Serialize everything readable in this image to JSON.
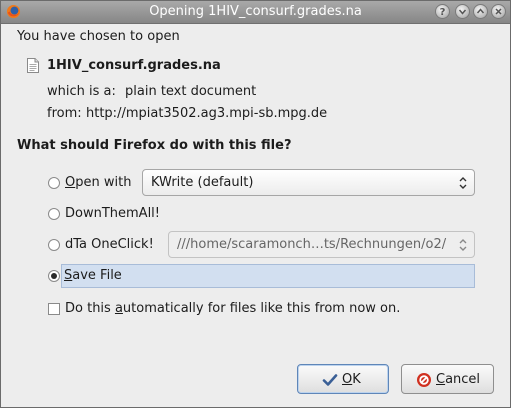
{
  "window": {
    "title": "Opening 1HIV_consurf.grades.na",
    "app_icon": "firefox-icon",
    "controls": [
      "help-icon",
      "minimize-icon",
      "maximize-icon",
      "close-icon"
    ]
  },
  "intro": {
    "chosen_text": "You have chosen to open",
    "file_icon": "text-file-icon",
    "file_name": "1HIV_consurf.grades.na",
    "type_label": "which is a:",
    "type_value": "plain text document",
    "from_label": "from:",
    "from_value": "http://mpiat3502.ag3.mpi-sb.mpg.de"
  },
  "question": "What should Firefox do with this file?",
  "options": {
    "open_with": {
      "label_mnemonic": "O",
      "label_rest": "pen with",
      "selected": false,
      "app": "KWrite (default)"
    },
    "downthemall": {
      "label": "DownThemAll!",
      "selected": false
    },
    "dta_oneclick": {
      "label": "dTa OneClick!",
      "selected": false,
      "path": "///home/scaramonch…ts/Rechnungen/o2/"
    },
    "save_file": {
      "label_mnemonic": "S",
      "label_rest": "ave File",
      "selected": true
    }
  },
  "auto": {
    "before": "Do this ",
    "mnemonic": "a",
    "after": "utomatically for files like this from now on.",
    "checked": false
  },
  "buttons": {
    "ok": {
      "mnemonic": "O",
      "rest": "K",
      "icon": "checkmark-icon"
    },
    "cancel": {
      "mnemonic": "C",
      "rest": "ancel",
      "icon": "cancel-icon"
    }
  },
  "colors": {
    "titlebar": "#979797",
    "selection": "#d2dff0",
    "cancel_red": "#d03020"
  }
}
